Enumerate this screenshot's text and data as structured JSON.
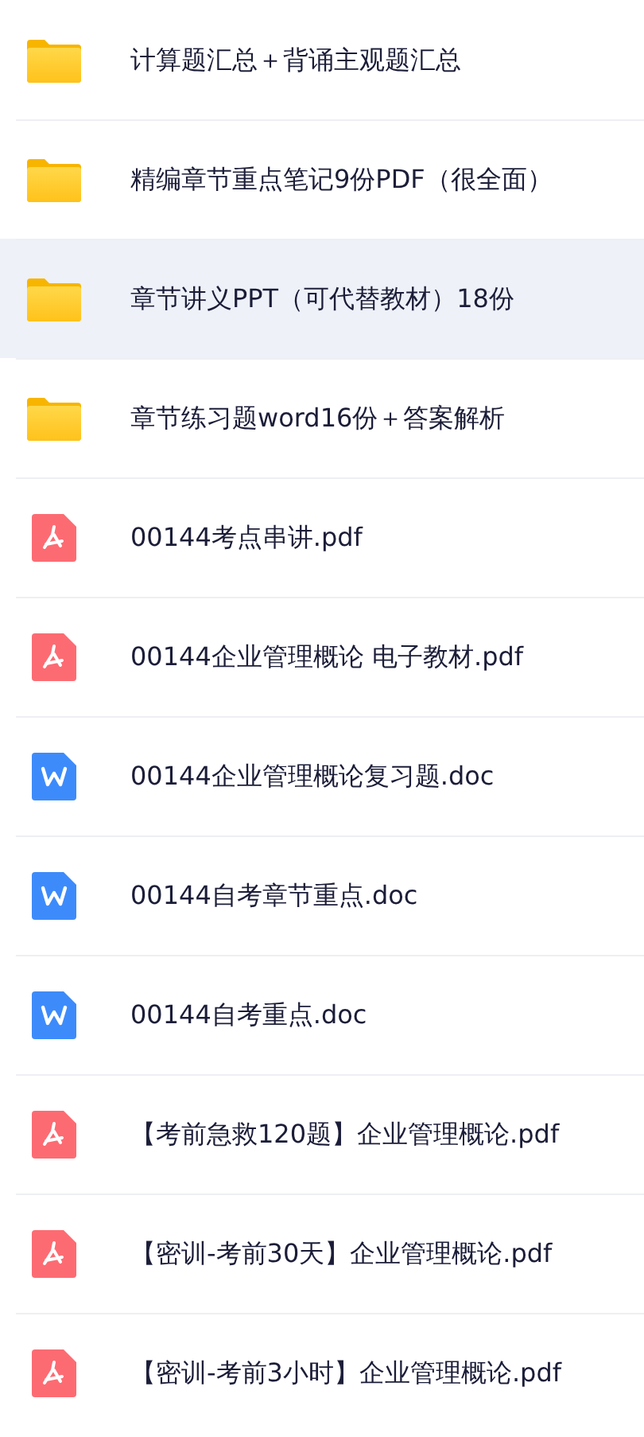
{
  "files": [
    {
      "kind": "folder",
      "name": "计算题汇总＋背诵主观题汇总",
      "selected": false
    },
    {
      "kind": "folder",
      "name": "精编章节重点笔记9份PDF（很全面）",
      "selected": false
    },
    {
      "kind": "folder",
      "name": "章节讲义PPT（可代替教材）18份",
      "selected": true
    },
    {
      "kind": "folder",
      "name": "章节练习题word16份＋答案解析",
      "selected": false
    },
    {
      "kind": "pdf",
      "name": "00144考点串讲.pdf",
      "selected": false
    },
    {
      "kind": "pdf",
      "name": "00144企业管理概论 电子教材.pdf",
      "selected": false
    },
    {
      "kind": "word",
      "name": "00144企业管理概论复习题.doc",
      "selected": false
    },
    {
      "kind": "word",
      "name": "00144自考章节重点.doc",
      "selected": false
    },
    {
      "kind": "word",
      "name": "00144自考重点.doc",
      "selected": false
    },
    {
      "kind": "pdf",
      "name": "【考前急救120题】企业管理概论.pdf",
      "selected": false
    },
    {
      "kind": "pdf",
      "name": "【密训-考前30天】企业管理概论.pdf",
      "selected": false
    },
    {
      "kind": "pdf",
      "name": "【密训-考前3小时】企业管理概论.pdf",
      "selected": false
    }
  ]
}
